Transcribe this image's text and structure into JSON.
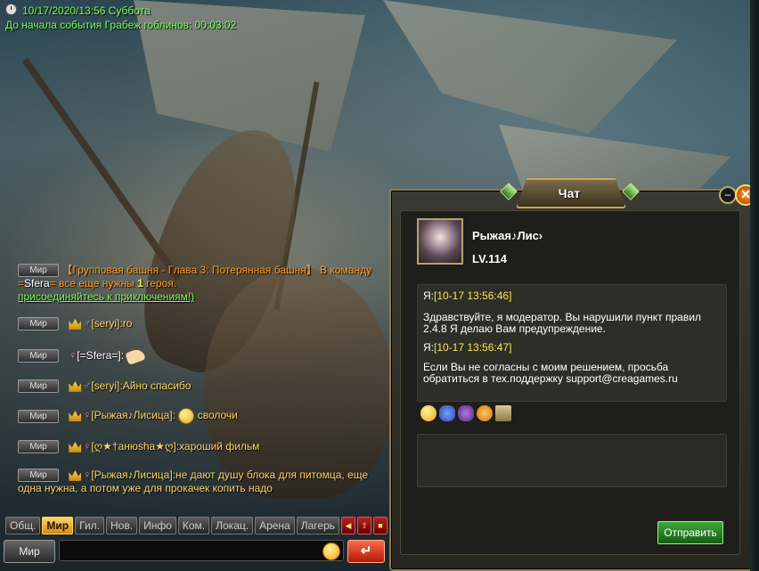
{
  "status": {
    "datetime": "10/17/2020/13:56 Суббота",
    "event_timer": "До начала события Грабеж гоблинов: 00:03:02"
  },
  "chat_log": {
    "channel_label": "Мир",
    "system_message": {
      "part1": "【Групповая башня - Глава 3: Потерянная башня】 В команду =",
      "player": "Sfera",
      "part2": "= все еще нужны ",
      "count": "1",
      "part3": " героя. ",
      "link": "присоединяйтесь к приключениям!)"
    },
    "messages": [
      {
        "author": "[seryi]",
        "sep": ":",
        "text": "ro"
      },
      {
        "author": "[=Sfera=]",
        "sep": ":",
        "text": ""
      },
      {
        "author": "[seryi]",
        "sep": ":",
        "text": "Айно спасибо"
      },
      {
        "author": "[Рыжая♪Лисица]",
        "sep": ":",
        "text": "сволочи"
      },
      {
        "author": "[ღ★†aнюshа★ღ]",
        "sep": ":",
        "text": "хароший фильм"
      },
      {
        "author": "[Рыжая♪Лисица]",
        "sep": ":",
        "text": "не дают душу блока для питомца, еще одна нужна, а потом уже для прокачек копить надо"
      }
    ]
  },
  "tabs": [
    "Общ.",
    "Мир",
    "Гил.",
    "Нов.",
    "Инфо",
    "Ком.",
    "Локац.",
    "Арена",
    "Лагерь"
  ],
  "input_bar": {
    "channel": "Мир",
    "enter_symbol": "↵"
  },
  "chat_window": {
    "title": "Чат",
    "close_symbol": "✕",
    "min_symbol": "–",
    "player_name": "Рыжая♪Лис›",
    "player_level": "LV.114",
    "entries": [
      {
        "speaker": "Я:",
        "time": "[10-17 13:56:46]",
        "text": "Здравствуйте, я модератор. Вы нарушили пункт правил 2.4.8 Я делаю Вам предупреждение."
      },
      {
        "speaker": "Я:",
        "time": "[10-17 13:56:47]",
        "text": "Если Вы не согласны с моим решением, просьба обратиться в тех.поддержку support@creagames.ru"
      }
    ],
    "send_label": "Отправить"
  },
  "icons": [
    "clock-icon",
    "crown-icon",
    "gender-icon",
    "smiley-icon",
    "thumbs-up-icon",
    "laughing-icon",
    "add-friend-icon",
    "remove-friend-icon",
    "block-icon",
    "note-icon",
    "arrow-left-icon",
    "arrow-up-icon",
    "lock-icon",
    "enter-icon"
  ],
  "colors": {
    "system_orange": "#ff9b2a",
    "timer_green": "#7cfc5a",
    "timestamp_yellow": "#ffe64a",
    "name_gold": "#ffd56a",
    "send_green": "#3fa83a"
  }
}
